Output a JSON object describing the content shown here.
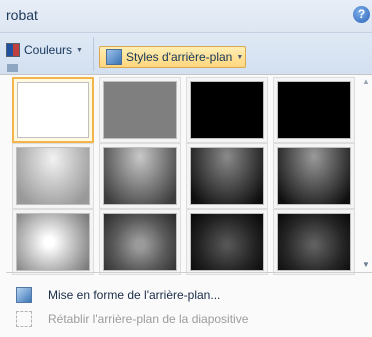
{
  "window": {
    "title": "robat"
  },
  "ribbon": {
    "couleurs_label": "Couleurs",
    "styles_label": "Styles d'arrière-plan"
  },
  "gallery": {
    "rows": 3,
    "columns": 4,
    "selected_index": 0,
    "thumbnails": [
      {
        "style": "blanc"
      },
      {
        "style": "gris"
      },
      {
        "style": "noir"
      },
      {
        "style": "noir"
      },
      {
        "style": "dégradé clair"
      },
      {
        "style": "dégradé moyen"
      },
      {
        "style": "dégradé sombre"
      },
      {
        "style": "dégradé sombre"
      },
      {
        "style": "dégradé radial clair"
      },
      {
        "style": "dégradé radial moyen"
      },
      {
        "style": "dégradé radial sombre"
      },
      {
        "style": "dégradé radial sombre"
      }
    ]
  },
  "menu": {
    "format_label": "Mise en forme de l'arrière-plan...",
    "reset_label": "Rétablir l'arrière-plan de la diapositive",
    "reset_disabled": true
  }
}
